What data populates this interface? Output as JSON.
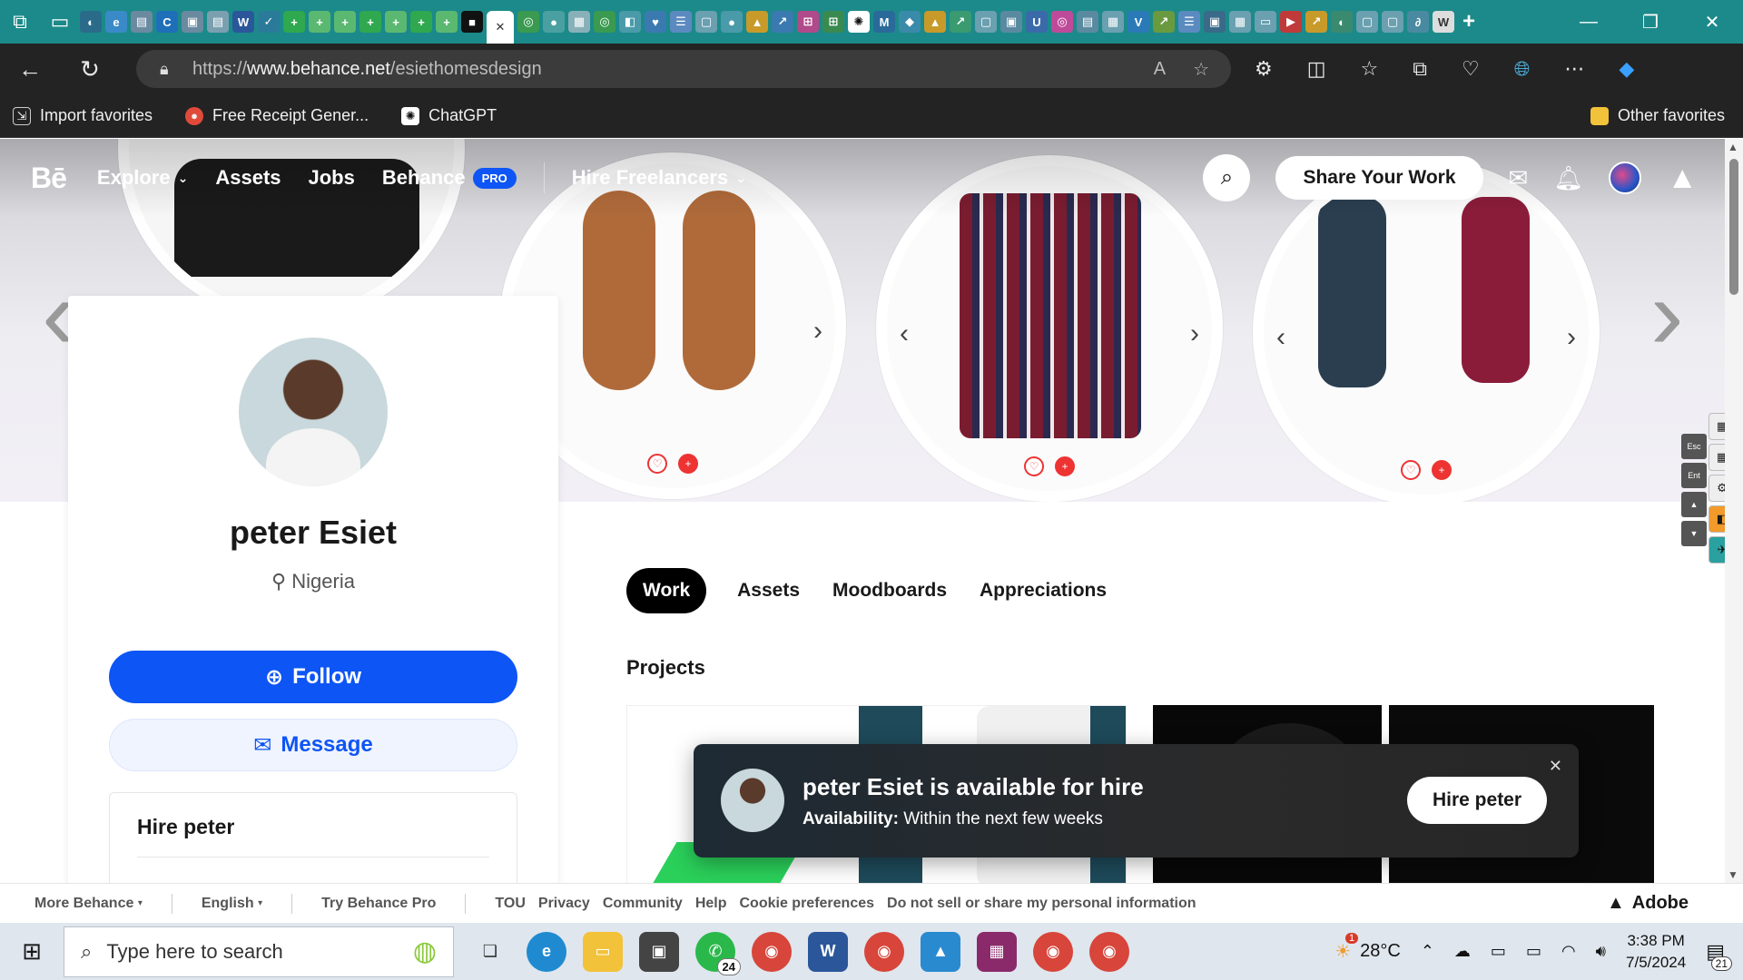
{
  "browser": {
    "url_prefix": "https://",
    "url_host": "www.behance.net",
    "url_path": "/esiethomesdesign",
    "favorites": [
      {
        "label": "Import favorites"
      },
      {
        "label": "Free Receipt Gener..."
      },
      {
        "label": "ChatGPT"
      }
    ],
    "other_favorites": "Other favorites"
  },
  "behance_nav": {
    "logo": "Bē",
    "explore": "Explore",
    "assets": "Assets",
    "jobs": "Jobs",
    "behance": "Behance",
    "pro_badge": "PRO",
    "hire_freelancers": "Hire Freelancers",
    "share_button": "Share Your Work"
  },
  "profile": {
    "name": "peter Esiet",
    "location": "Nigeria",
    "follow_label": "Follow",
    "message_label": "Message",
    "hire_title": "Hire peter"
  },
  "tabs": [
    {
      "label": "Work",
      "active": true
    },
    {
      "label": "Assets",
      "active": false
    },
    {
      "label": "Moodboards",
      "active": false
    },
    {
      "label": "Appreciations",
      "active": false
    }
  ],
  "projects_title": "Projects",
  "toast": {
    "title": "peter Esiet is available for hire",
    "availability_label": "Availability:",
    "availability_value": "Within the next few weeks",
    "hire_button": "Hire peter"
  },
  "footer": {
    "more_behance": "More Behance",
    "language": "English",
    "try_pro": "Try Behance Pro",
    "tou": "TOU",
    "privacy": "Privacy",
    "community": "Community",
    "help": "Help",
    "cookies": "Cookie preferences",
    "do_not_sell": "Do not sell or share my personal information",
    "adobe": "Adobe"
  },
  "taskbar": {
    "search_placeholder": "Type here to search",
    "whatsapp_badge": "24",
    "temperature": "28°C",
    "weather_badge": "1",
    "time": "3:38 PM",
    "date": "7/5/2024",
    "notifications": "21"
  },
  "colors": {
    "tabstrip": "#1c8a8a",
    "behance_blue": "#0d55f5"
  }
}
